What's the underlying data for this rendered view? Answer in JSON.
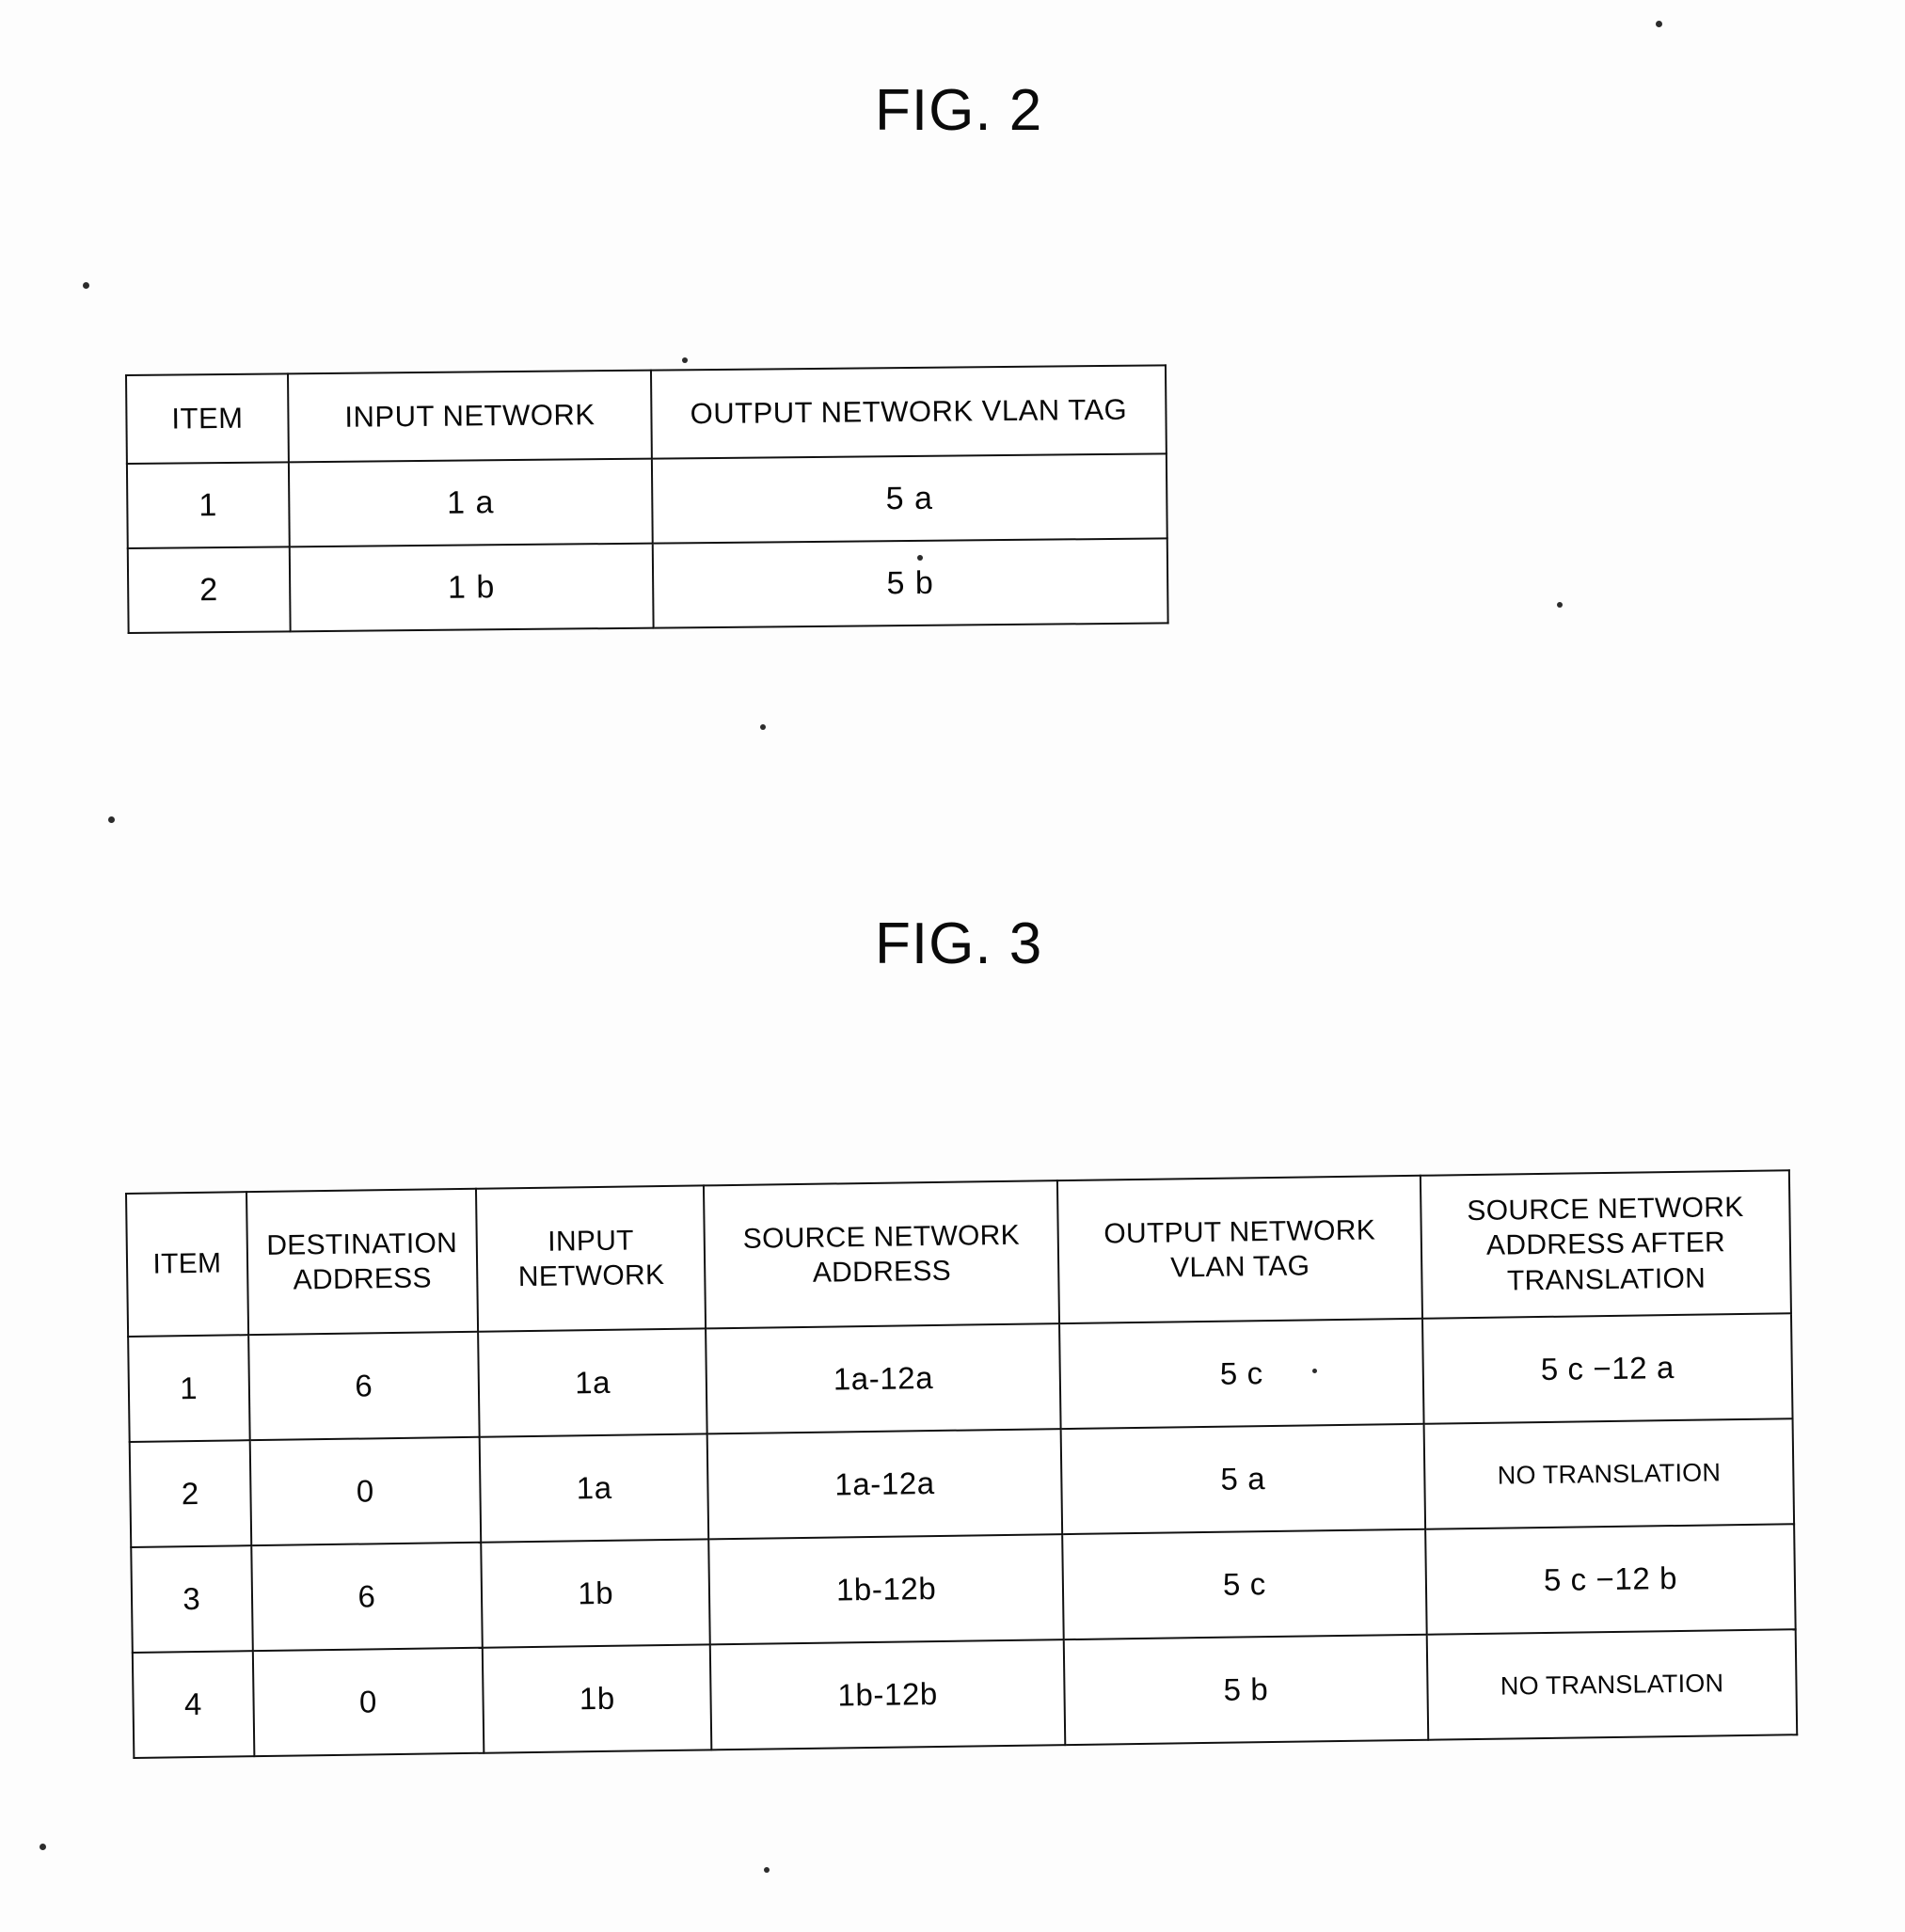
{
  "figures": [
    {
      "title": "FIG. 2",
      "table": {
        "headers": [
          "ITEM",
          "INPUT NETWORK",
          "OUTPUT NETWORK VLAN TAG"
        ],
        "rows": [
          [
            "1",
            "1 a",
            "5 a"
          ],
          [
            "2",
            "1 b",
            "5 b"
          ]
        ]
      }
    },
    {
      "title": "FIG. 3",
      "table": {
        "headers": [
          "ITEM",
          "DESTINATION ADDRESS",
          "INPUT NETWORK",
          "SOURCE NETWORK ADDRESS",
          "OUTPUT NETWORK VLAN TAG",
          "SOURCE NETWORK ADDRESS AFTER TRANSLATION"
        ],
        "header_lines": [
          [
            "ITEM"
          ],
          [
            "DESTINATION",
            "ADDRESS"
          ],
          [
            "INPUT",
            "NETWORK"
          ],
          [
            "SOURCE NETWORK",
            "ADDRESS"
          ],
          [
            "OUTPUT NETWORK",
            "VLAN TAG"
          ],
          [
            "SOURCE NETWORK",
            "ADDRESS AFTER",
            "TRANSLATION"
          ]
        ],
        "rows": [
          [
            "1",
            "6",
            "1a",
            "1a-12a",
            "5 c",
            "5 c −12 a"
          ],
          [
            "2",
            "0",
            "1a",
            "1a-12a",
            "5 a",
            "NO TRANSLATION"
          ],
          [
            "3",
            "6",
            "1b",
            "1b-12b",
            "5 c",
            "5 c −12 b"
          ],
          [
            "4",
            "0",
            "1b",
            "1b-12b",
            "5 b",
            "NO TRANSLATION"
          ]
        ]
      }
    }
  ],
  "colors": {
    "ink": "#111111",
    "paper": "#ffffff"
  }
}
